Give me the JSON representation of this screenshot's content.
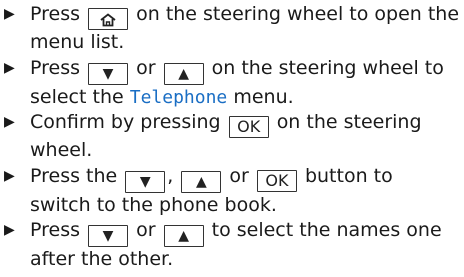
{
  "steps": [
    {
      "pre": "Press",
      "key1": "home",
      "post": "on the steering wheel to open the",
      "line2": "menu list."
    },
    {
      "pre": "Press",
      "key1": "▼",
      "mid": "or",
      "key2": "▲",
      "post": "on the steering wheel to",
      "line2_pre": "select the",
      "menu_name": "Telephone",
      "line2_post": "menu."
    },
    {
      "pre": "Confirm by pressing",
      "key1": "OK",
      "post": "on the steering",
      "line2": "wheel."
    },
    {
      "pre": "Press the",
      "key1": "▼",
      "sep1": ",",
      "key2": "▲",
      "mid": "or",
      "key3": "OK",
      "post": "button to",
      "line2": "switch to the phone book."
    },
    {
      "pre": "Press",
      "key1": "▼",
      "mid": "or",
      "key2": "▲",
      "post": "to select the names one",
      "line2": "after the other."
    }
  ],
  "bullet_glyph": "▶",
  "colors": {
    "menu_name": "#1a6ec4",
    "text": "#1a1a1a"
  }
}
